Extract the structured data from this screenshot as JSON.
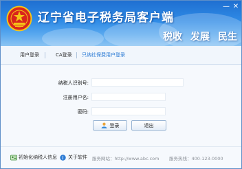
{
  "app": {
    "title": "辽宁省电子税务局客户端",
    "slogans": [
      "税收",
      "发展",
      "民生"
    ]
  },
  "window_controls": {
    "minimize": "—",
    "close": "✕"
  },
  "tabs": [
    {
      "label": "用户登录",
      "active": false
    },
    {
      "label": "CA登录",
      "active": false
    },
    {
      "label": "只纳社保费用户登录",
      "active": true
    }
  ],
  "form": {
    "taxpayer_id_label": "纳税人识别号:",
    "username_label": "注册用户名:",
    "password_label": "密码:",
    "login_label": "登录",
    "exit_label": "退出"
  },
  "footer": {
    "init_label": "初始化纳税人信息",
    "about_label": "关于软件",
    "site_text": "服务网站：http://www.abc.com",
    "hotline_text": "服务热线：400-123-0000"
  },
  "colors": {
    "banner": "#2f8be6",
    "accent": "#2a7ad4"
  }
}
